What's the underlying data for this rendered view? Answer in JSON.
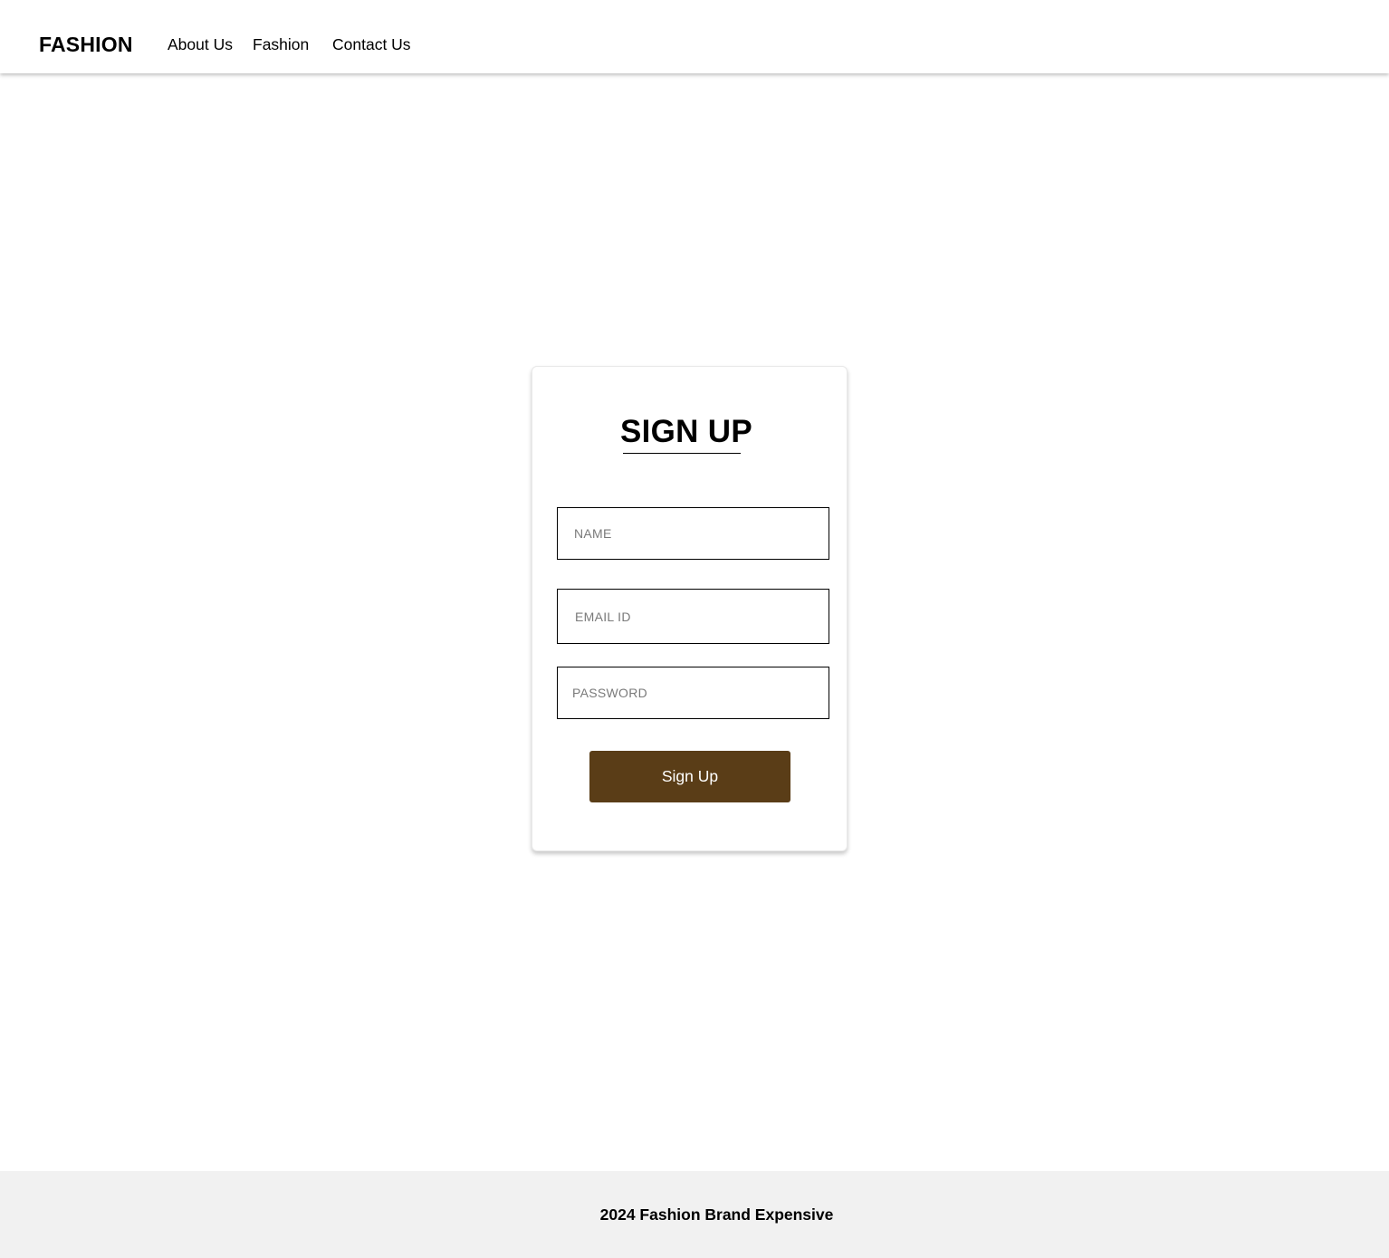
{
  "header": {
    "brand": "FASHION",
    "nav": {
      "about": "About Us",
      "fashion": "Fashion",
      "contact": "Contact Us"
    }
  },
  "signup": {
    "title": "SIGN UP",
    "name_placeholder": "NAME",
    "name_value": "",
    "email_placeholder": "EMAIL ID",
    "email_value": "",
    "password_placeholder": "PASSWORD",
    "password_value": "",
    "button_label": "Sign Up"
  },
  "footer": {
    "text": "2024 Fashion Brand Expensive"
  },
  "colors": {
    "button_bg": "#5a3d17",
    "footer_bg": "#f1f1f1"
  }
}
